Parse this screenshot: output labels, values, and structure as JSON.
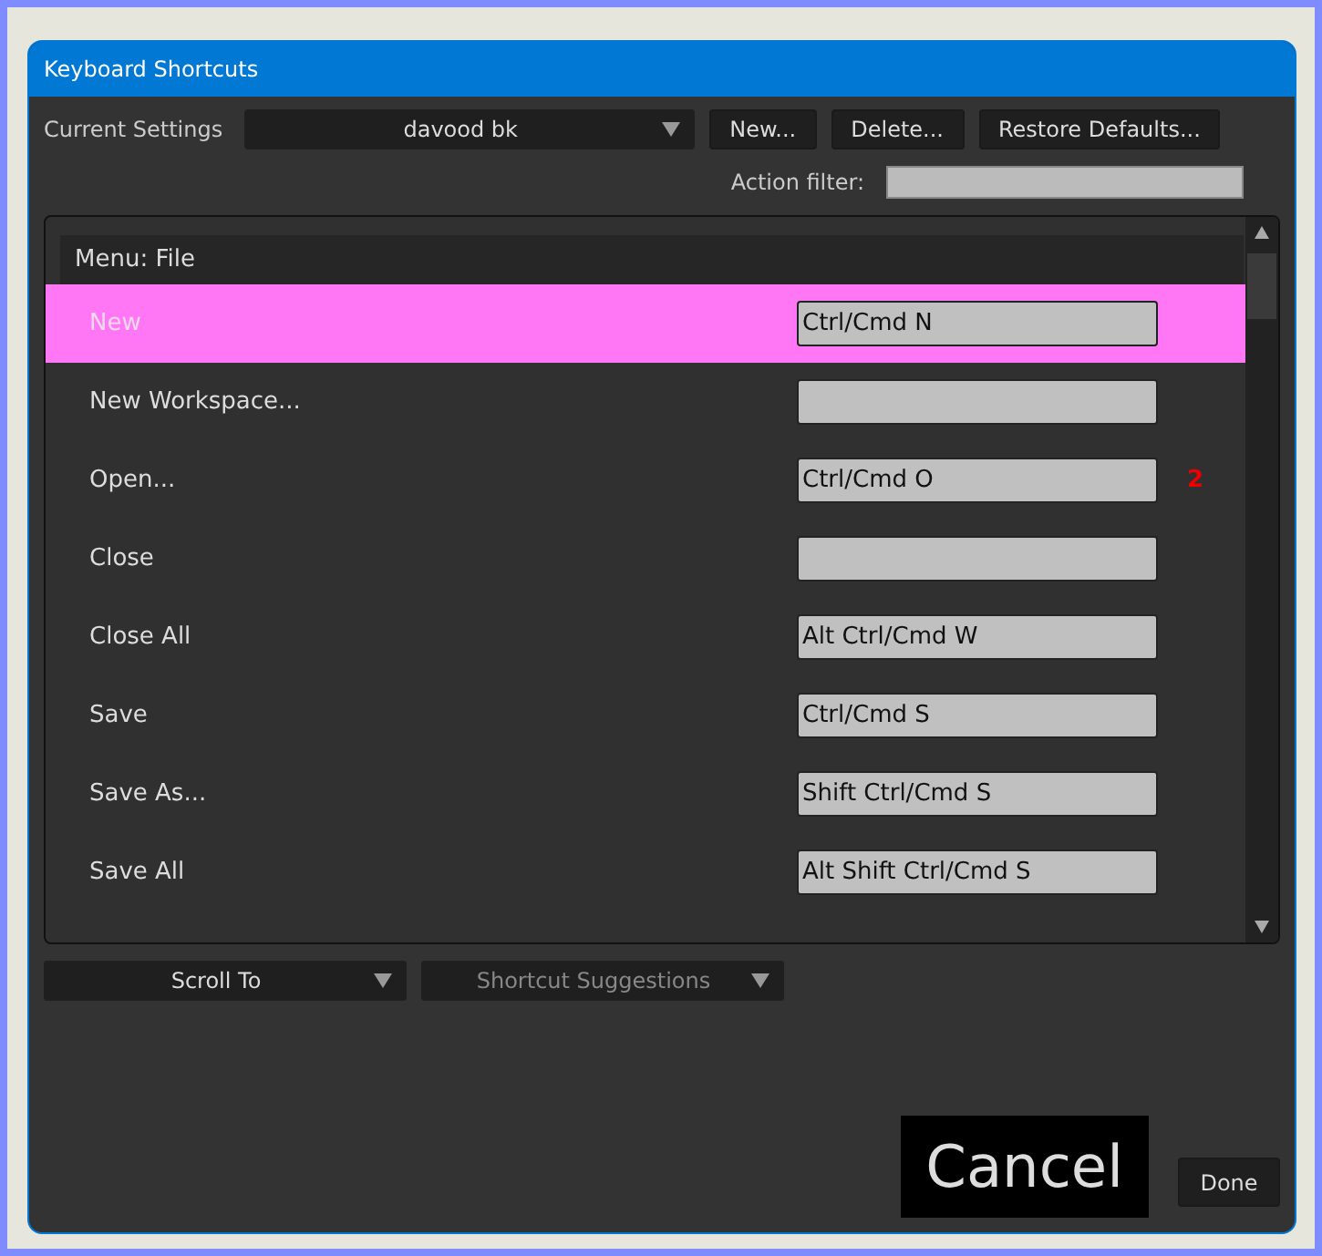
{
  "window": {
    "title": "Keyboard Shortcuts"
  },
  "settings": {
    "label": "Current Settings",
    "value": "davood bk",
    "buttons": [
      "New...",
      "Delete...",
      "Restore Defaults..."
    ]
  },
  "filter": {
    "label": "Action filter:"
  },
  "section": {
    "title": "Menu: File"
  },
  "rows": [
    {
      "label": "New",
      "shortcut": "Ctrl/Cmd N",
      "selected": true
    },
    {
      "label": "New Workspace...",
      "selected": false
    },
    {
      "label": "Open...",
      "shortcut": "Ctrl/Cmd O",
      "selected": false,
      "conflicts": "2"
    },
    {
      "label": "Close",
      "selected": false
    },
    {
      "label": "Close All",
      "shortcut": "Alt Ctrl/Cmd W",
      "selected": false
    },
    {
      "label": "Save",
      "shortcut": "Ctrl/Cmd S",
      "selected": false
    },
    {
      "label": "Save As...",
      "shortcut": "Shift Ctrl/Cmd S",
      "selected": false
    },
    {
      "label": "Save All",
      "shortcut": "Alt Shift Ctrl/Cmd S",
      "selected": false
    }
  ],
  "bottom": {
    "scroll_to": "Scroll To",
    "suggestions": {
      "label": "Shortcut Suggestions",
      "disabled": true
    }
  },
  "buttons": {
    "cancel": "Cancel",
    "done": "Done"
  }
}
